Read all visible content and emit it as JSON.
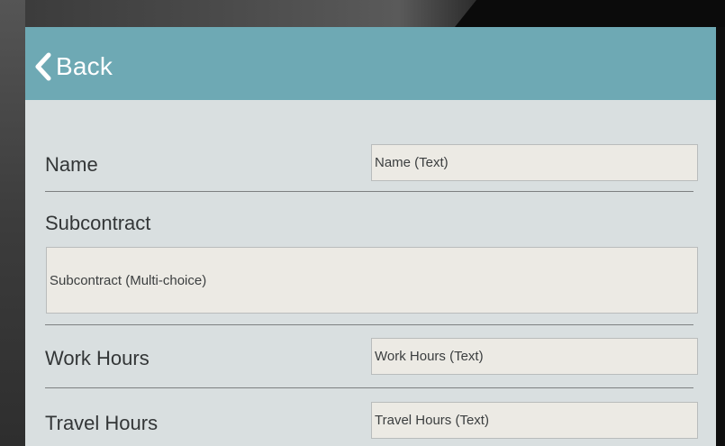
{
  "header": {
    "back_label": "Back",
    "background": "#6ea9b4"
  },
  "form": {
    "name": {
      "label": "Name",
      "placeholder": "Name (Text)"
    },
    "subcontract": {
      "label": "Subcontract",
      "placeholder": "Subcontract (Multi-choice)"
    },
    "work_hours": {
      "label": "Work Hours",
      "placeholder": "Work Hours (Text)"
    },
    "travel_hours": {
      "label": "Travel Hours",
      "placeholder": "Travel Hours (Text)"
    }
  },
  "icons": {
    "back": "chevron-left-icon"
  }
}
